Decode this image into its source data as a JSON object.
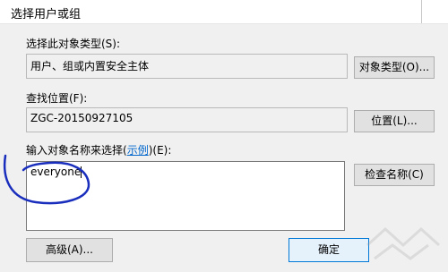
{
  "window": {
    "title": "选择用户或组"
  },
  "object_type": {
    "label": "选择此对象类型(S):",
    "value": "用户、组或内置安全主体",
    "button": "对象类型(O)..."
  },
  "location": {
    "label": "查找位置(F):",
    "value": "ZGC-20150927105",
    "button": "位置(L)..."
  },
  "names": {
    "label_pre": "输入对象名称来选择(",
    "label_link": "示例",
    "label_post": ")(E):",
    "value": "everyone",
    "check_button": "检查名称(C)"
  },
  "footer": {
    "advanced_button": "高级(A)...",
    "ok_button": "确定"
  },
  "colors": {
    "annotation": "#1a2ebd",
    "link": "#0066cc",
    "dialog_bg": "#f0f0f0"
  }
}
